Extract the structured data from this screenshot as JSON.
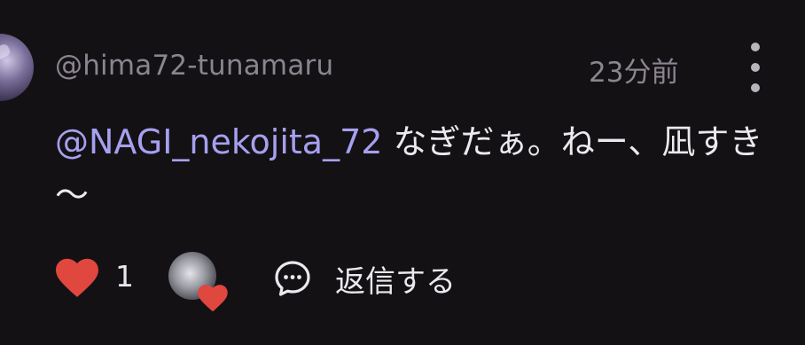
{
  "comment": {
    "username": "@hima72-tunamaru",
    "timestamp": "23分前",
    "mention": "@NAGI_nekojita_72",
    "text": " なぎだぁ。ねー、凪すき～",
    "like_count": "1",
    "reply_label": "返信する"
  },
  "icons": {
    "avatar": "user-avatar",
    "menu": "more-vert-icon",
    "like": "heart-icon",
    "creator_heart": "creator-heart-icon",
    "reply": "comment-bubble-icon"
  },
  "colors": {
    "background": "#141114",
    "mention": "#a6a0f0",
    "heart": "#e0473f",
    "muted_text": "#8a8590",
    "primary_text": "#ebe8ef"
  }
}
